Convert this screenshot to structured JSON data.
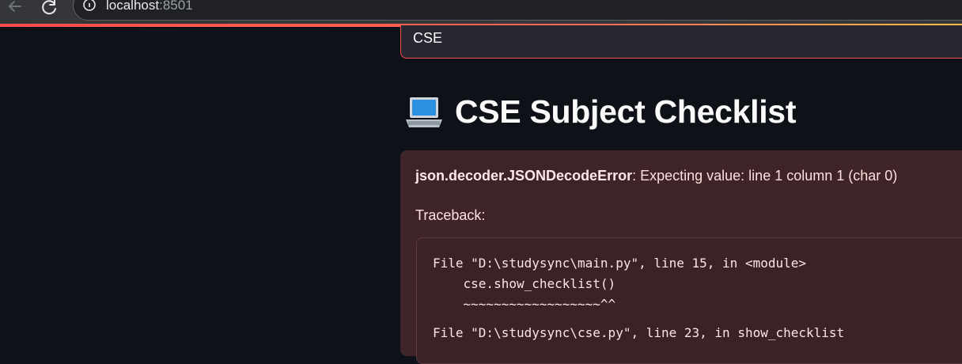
{
  "browser": {
    "url_host": "localhost",
    "url_port": ":8501"
  },
  "select": {
    "value": "CSE"
  },
  "heading": {
    "icon": "laptop-icon",
    "title": "CSE Subject Checklist"
  },
  "error": {
    "type": "json.decoder.JSONDecodeError",
    "message": ": Expecting value: line 1 column 1 (char 0)",
    "traceback_label": "Traceback:",
    "code_lines": [
      "File \"D:\\studysync\\main.py\", line 15, in <module>",
      "    cse.show_checklist()",
      "    ~~~~~~~~~~~~~~~~~~^^",
      "File \"D:\\studysync\\cse.py\", line 23, in show_checklist"
    ]
  },
  "colors": {
    "accent": "#ff4b4b",
    "background": "#0e1117",
    "error_bg": "#3e2428"
  }
}
